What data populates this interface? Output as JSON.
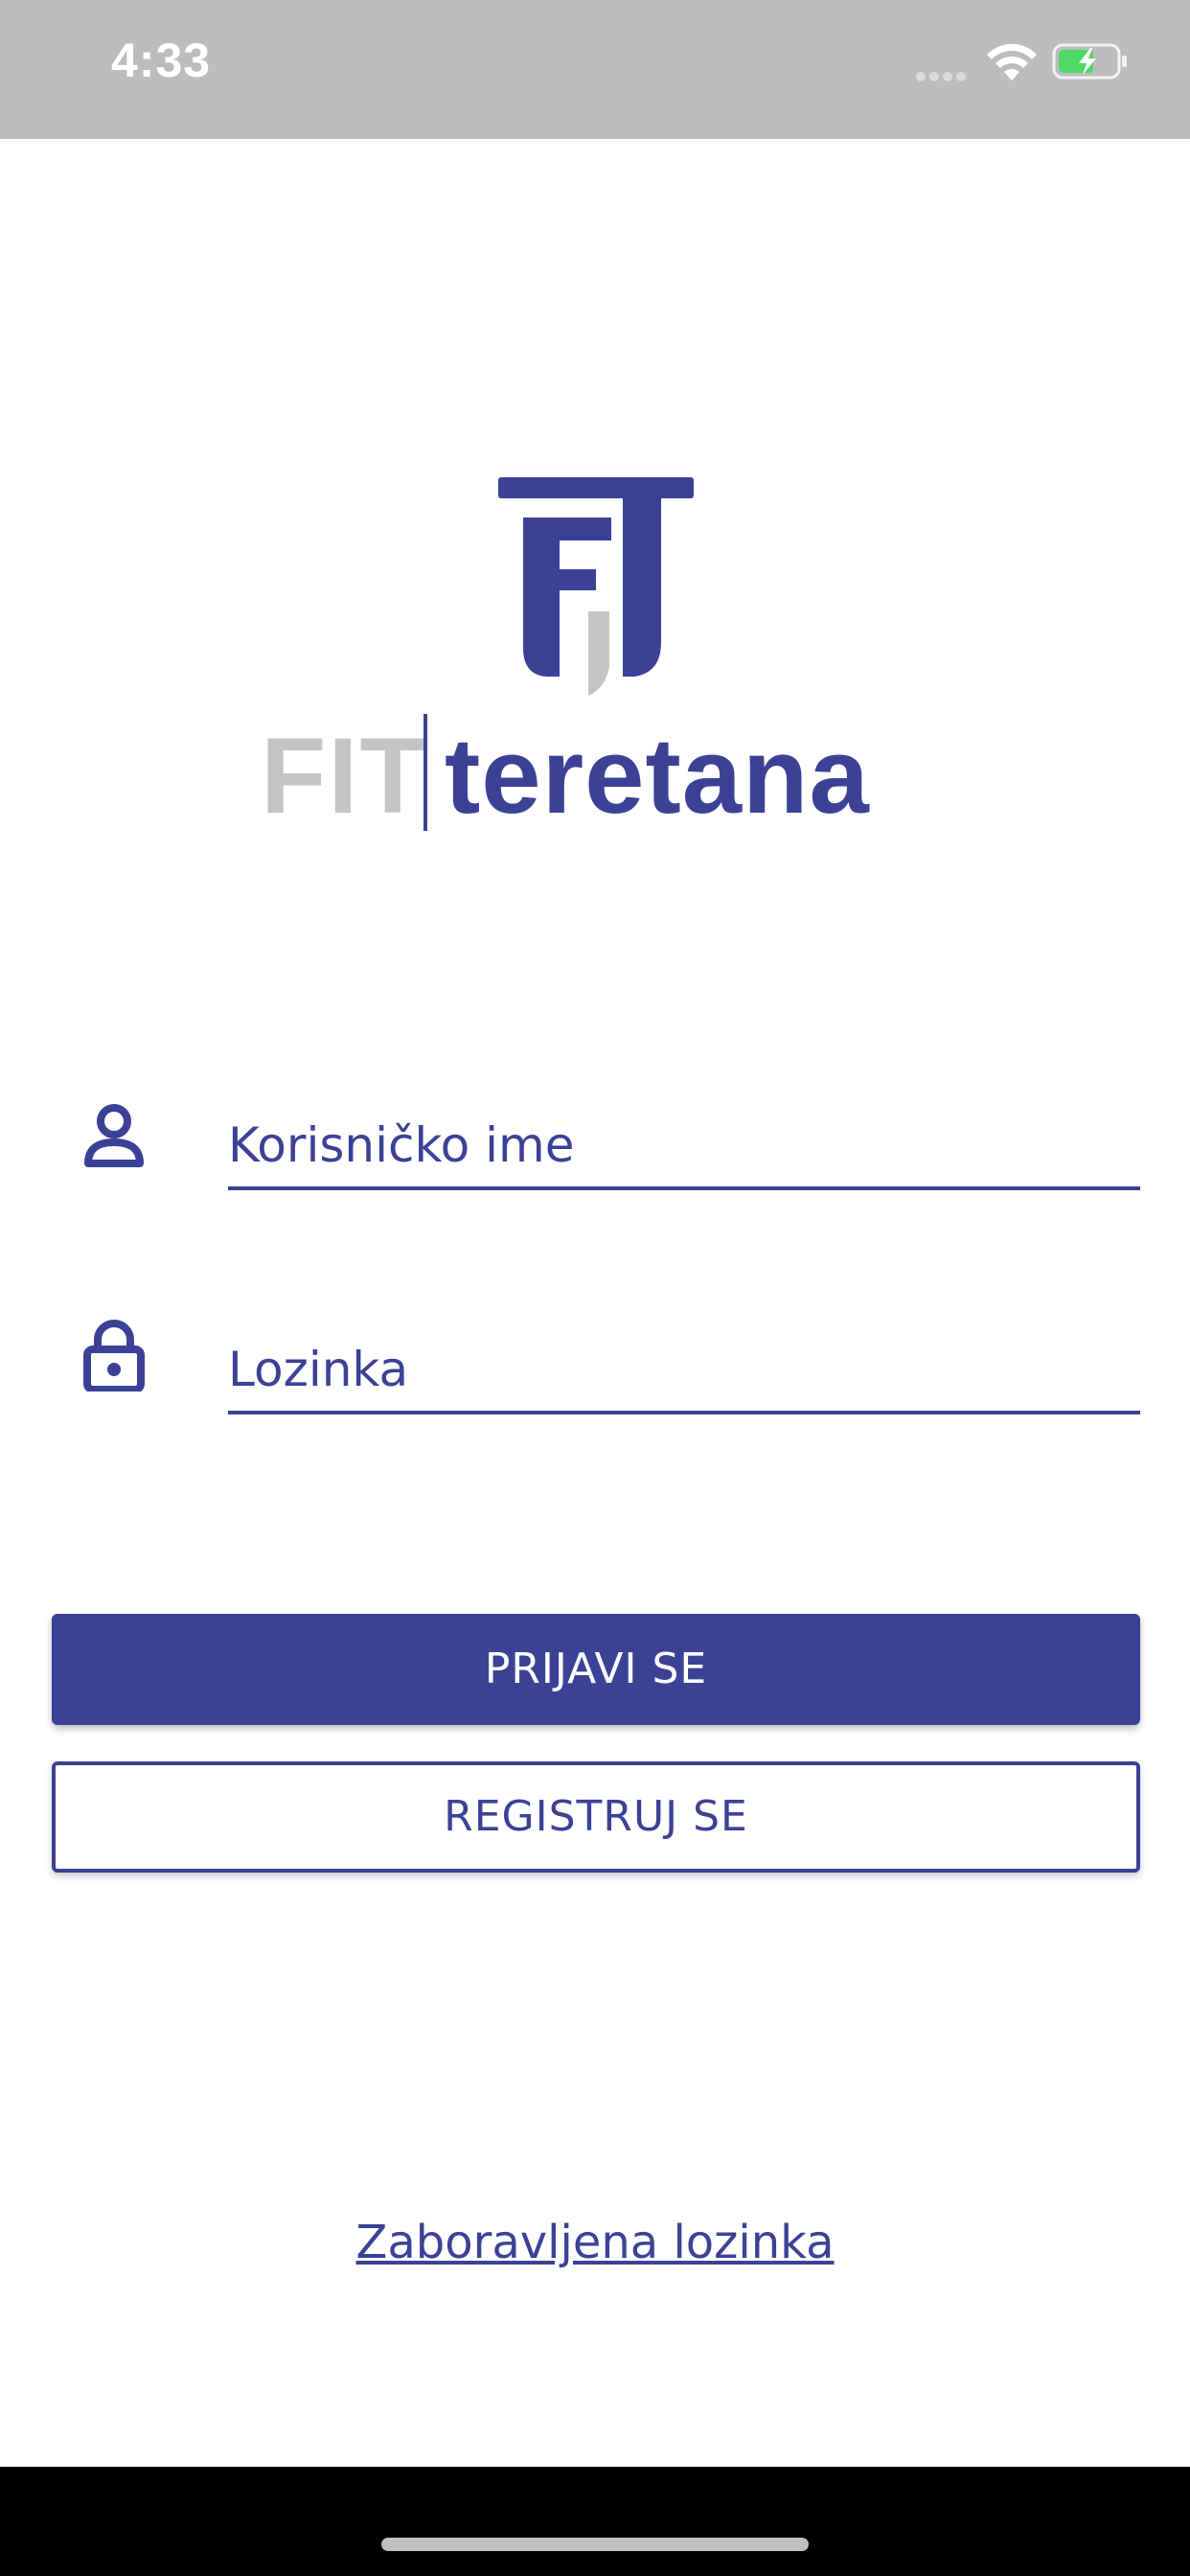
{
  "status_bar": {
    "time": "4:33",
    "icons": [
      "signal-dots-icon",
      "wifi-icon",
      "battery-charging-icon"
    ]
  },
  "logo": {
    "brand_left": "FIT",
    "brand_right": "teretana",
    "colors": {
      "primary": "#3b4296",
      "secondary": "#c4c4c4"
    }
  },
  "form": {
    "username": {
      "placeholder": "Korisničko ime",
      "icon": "user-icon"
    },
    "password": {
      "placeholder": "Lozinka",
      "icon": "lock-icon"
    }
  },
  "buttons": {
    "login_label": "PRIJAVI SE",
    "register_label": "REGISTRUJ SE"
  },
  "links": {
    "forgot_password": "Zaboravljena lozinka"
  },
  "theme": {
    "accent": "#3b4296",
    "status_bar_bg": "#bcbdbf"
  }
}
